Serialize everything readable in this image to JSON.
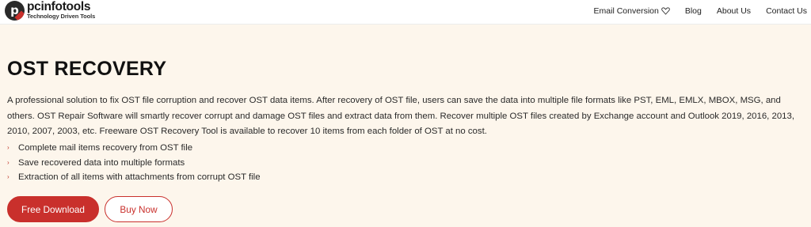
{
  "brand": {
    "name": "pcinfotools",
    "tagline": "Technology Driven Tools",
    "logo_letter": "p",
    "accent_color": "#c9302c"
  },
  "nav": {
    "items": [
      {
        "label": "Email Conversion",
        "has_dropdown": true
      },
      {
        "label": "Blog"
      },
      {
        "label": "About Us"
      },
      {
        "label": "Contact Us"
      }
    ]
  },
  "hero": {
    "title": "OST RECOVERY",
    "description": "A professional solution to fix OST file corruption and recover OST data items. After recovery of OST file, users can save the data into multiple file formats like PST, EML, EMLX, MBOX, MSG, and others. OST Repair Software will smartly recover corrupt and damage OST files and extract data from them. Recover multiple OST files created by Exchange account and Outlook 2019, 2016, 2013, 2010, 2007, 2003, etc. Freeware OST Recovery Tool is available to recover 10 items from each folder of OST at no cost.",
    "bullet_glyph": "›",
    "features": [
      "Complete mail items recovery from OST file",
      "Save recovered data into multiple formats",
      "Extraction of all items with attachments from corrupt OST file"
    ],
    "primary_button": "Free Download",
    "secondary_button": "Buy Now"
  }
}
